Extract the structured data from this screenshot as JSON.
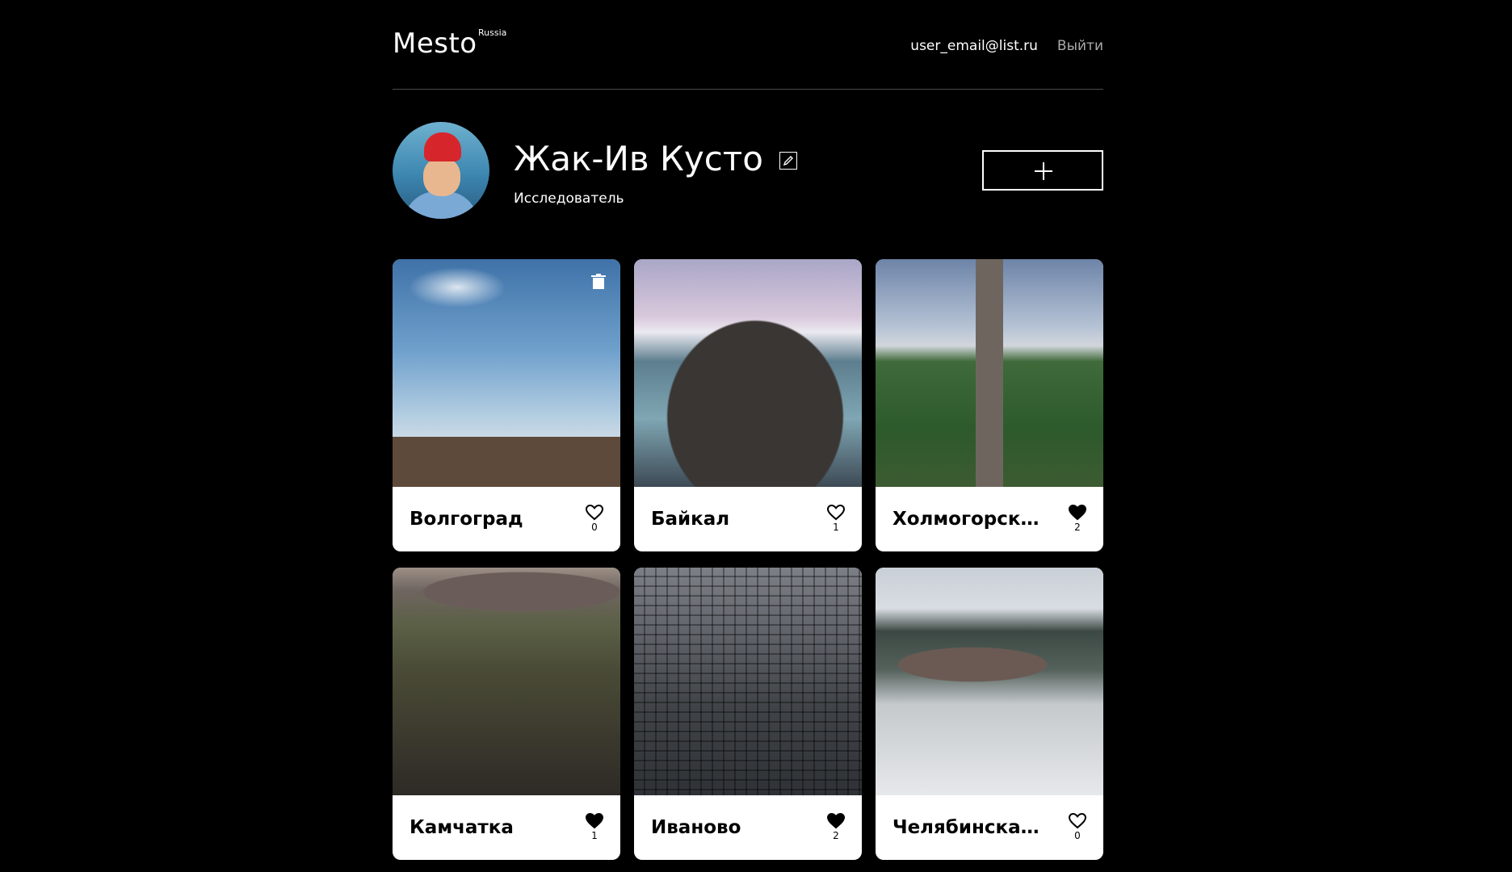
{
  "header": {
    "logo": "Mesto",
    "logo_sup": "Russia",
    "user_email": "user_email@list.ru",
    "logout": "Выйти"
  },
  "profile": {
    "name": "Жак-Ив Кусто",
    "about": "Исследователь"
  },
  "cards": [
    {
      "title": "Волгоград",
      "likes": "0",
      "liked": false,
      "owner": true
    },
    {
      "title": "Байкал",
      "likes": "1",
      "liked": false,
      "owner": false
    },
    {
      "title": "Холмогорский район",
      "likes": "2",
      "liked": true,
      "owner": false
    },
    {
      "title": "Камчатка",
      "likes": "1",
      "liked": true,
      "owner": false
    },
    {
      "title": "Иваново",
      "likes": "2",
      "liked": true,
      "owner": false
    },
    {
      "title": "Челябинская область",
      "likes": "0",
      "liked": false,
      "owner": false
    }
  ],
  "icons": {
    "edit": "pencil-icon",
    "add": "plus-icon",
    "like": "heart-icon",
    "delete": "trash-icon"
  }
}
